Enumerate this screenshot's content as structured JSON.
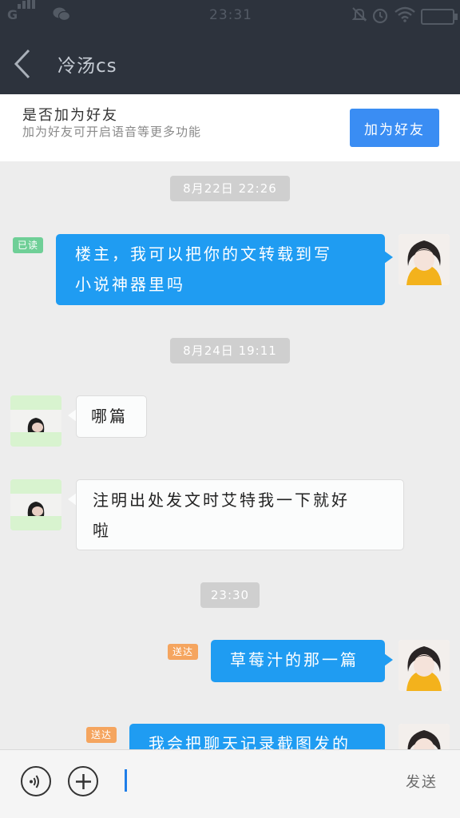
{
  "status_bar": {
    "network": "G",
    "time": "23:31",
    "icons": [
      "signal-icon",
      "wechat-icon",
      "mute-icon",
      "alarm-icon",
      "wifi-icon",
      "battery-icon"
    ]
  },
  "nav": {
    "title": "冷汤cs",
    "back_icon": "back-chevron-icon"
  },
  "banner": {
    "title": "是否加为好友",
    "subtitle": "加为好友可开启语音等更多功能",
    "button_label": "加为好友"
  },
  "messages": [
    {
      "type": "time",
      "text": "8月22日 22:26"
    },
    {
      "type": "msg",
      "side": "me",
      "status": "已读",
      "lines": [
        "楼主，我可以把你的文转载到写",
        "小说神器里吗"
      ]
    },
    {
      "type": "time",
      "text": "8月24日 19:11"
    },
    {
      "type": "msg",
      "side": "other",
      "lines": [
        "哪篇"
      ]
    },
    {
      "type": "msg",
      "side": "other",
      "lines": [
        "注明出处发文时艾特我一下就好",
        "啦"
      ]
    },
    {
      "type": "time",
      "text": "23:30"
    },
    {
      "type": "msg",
      "side": "me",
      "status": "送达",
      "lines": [
        "草莓汁的那一篇"
      ]
    },
    {
      "type": "msg",
      "side": "me",
      "status": "送达",
      "lines": [
        "我会把聊天记录截图发的"
      ]
    }
  ],
  "input_bar": {
    "voice_icon": "voice-icon",
    "add_icon": "plus-circle-icon",
    "send_label": "发送"
  },
  "colors": {
    "header_bg": "#2d333d",
    "accent_blue": "#3a8df3",
    "bubble_out": "#1f9cf2",
    "read_badge": "#6fcf97",
    "sent_badge": "#f5a55f"
  }
}
